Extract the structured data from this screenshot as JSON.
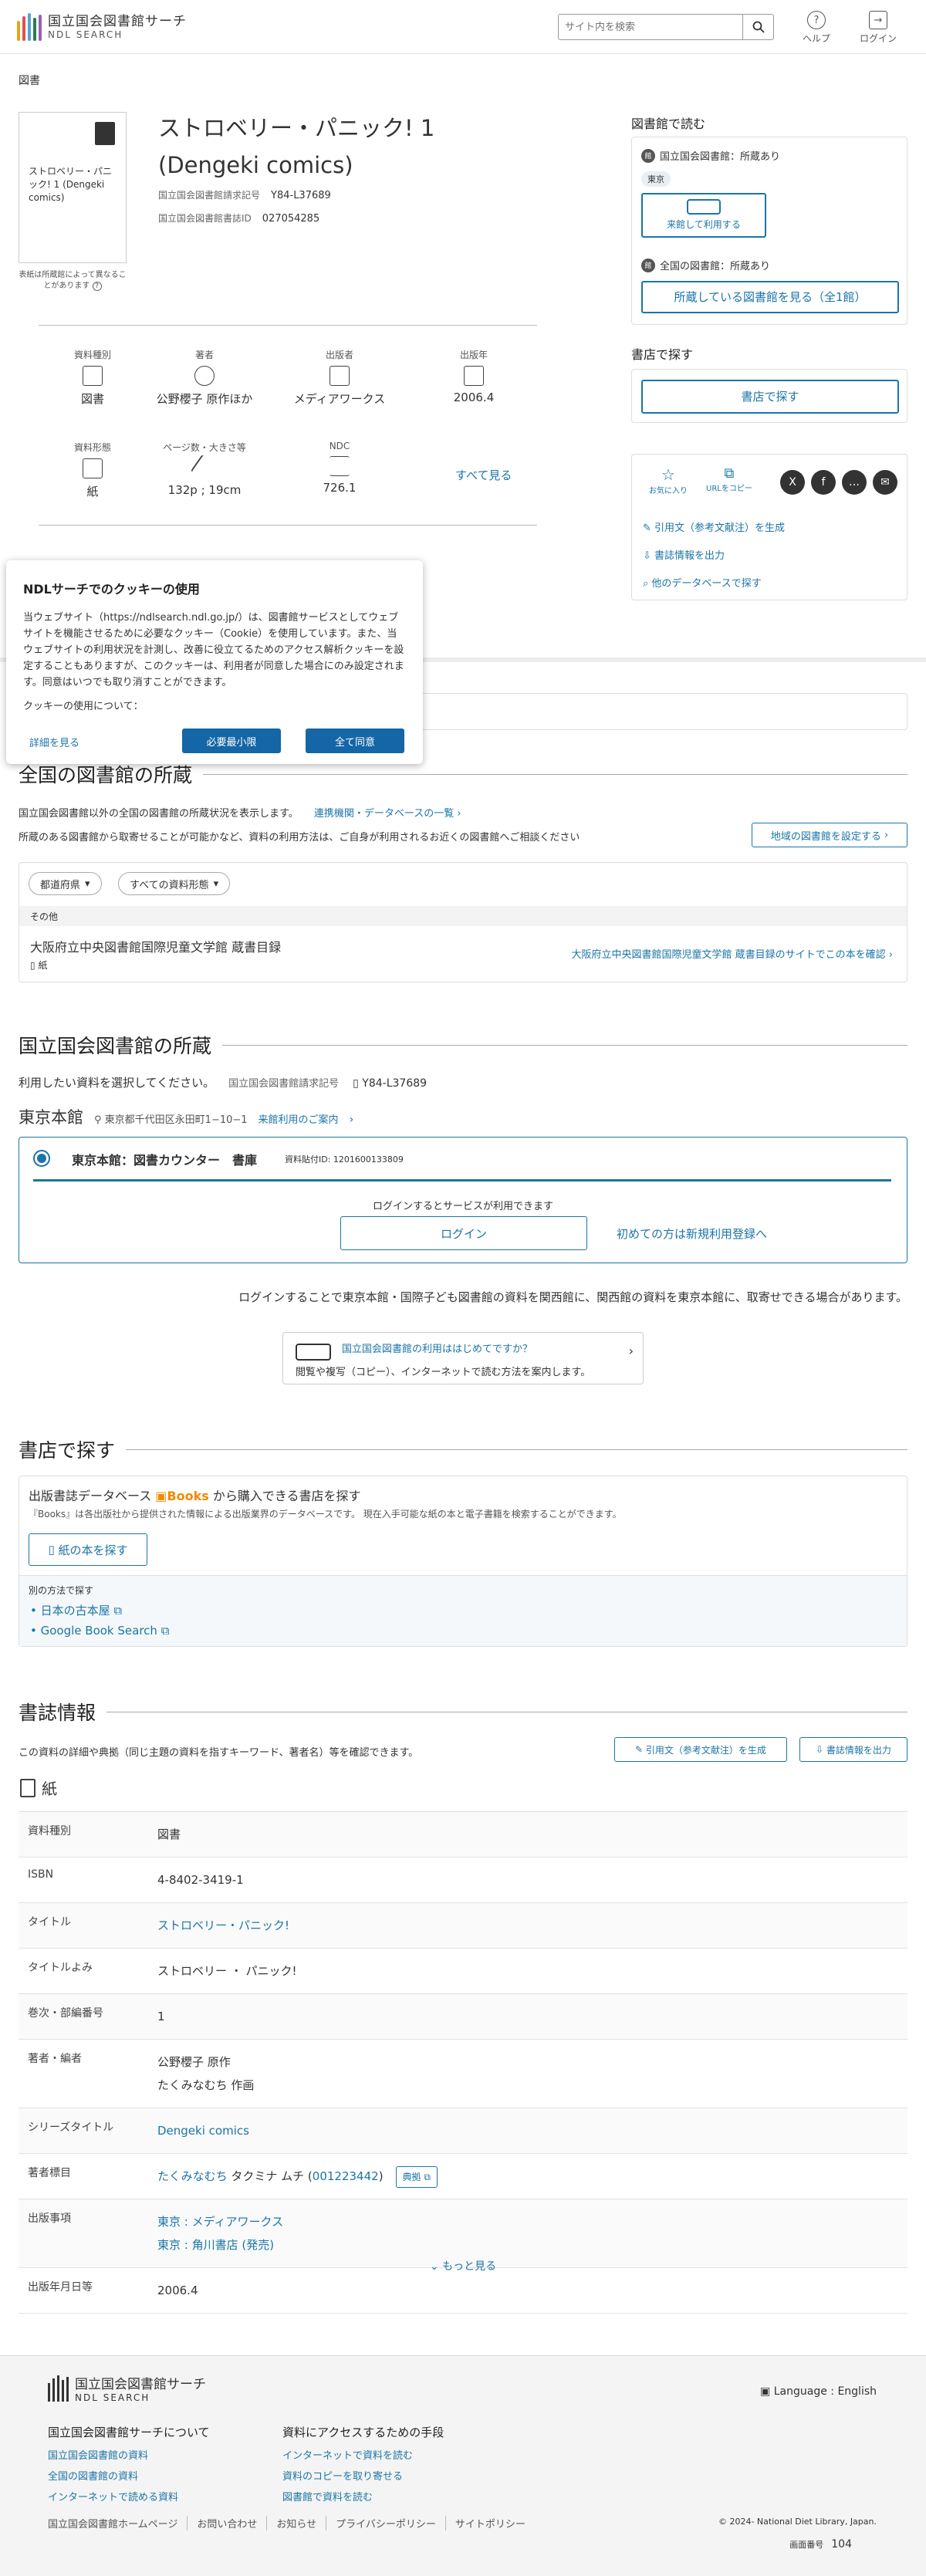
{
  "header": {
    "logo_title": "国立国会図書館サーチ",
    "logo_sub": "NDL SEARCH",
    "search_placeholder": "サイト内を検索",
    "help": "ヘルプ",
    "login": "ログイン"
  },
  "breadcrumb": "図書",
  "book": {
    "cover_text": "ストロベリー・パニック! 1 (Dengeki comics)",
    "cover_note": "表紙は所蔵館によって異なることがあります",
    "title_line1": "ストロベリー・パニック! 1",
    "title_line2": "(Dengeki comics)",
    "call_label": "国立国会図書館請求記号",
    "call_value": "Y84-L37689",
    "id_label": "国立国会図書館書誌ID",
    "id_value": "027054285"
  },
  "facets": [
    {
      "label": "資料種別",
      "value": "図書"
    },
    {
      "label": "著者",
      "value": "公野櫻子 原作ほか"
    },
    {
      "label": "出版者",
      "value": "メディアワークス"
    },
    {
      "label": "出版年",
      "value": "2006.4"
    },
    {
      "label": "資料形態",
      "value": "紙"
    },
    {
      "label": "ページ数・大きさ等",
      "value": "132p ; 19cm"
    },
    {
      "label": "NDC",
      "value": "726.1"
    }
  ],
  "see_all": "すべて見る",
  "sidebar": {
    "read_heading": "図書館で読む",
    "ndl_holding": "国立国会図書館：所蔵あり",
    "tokyo_pill": "東京",
    "visit_button": "来館して利用する",
    "all_holding": "全国の図書館：所蔵あり",
    "see_libraries_button": "所蔵している図書館を見る（全1館）",
    "shop_heading": "書店で探す",
    "shop_button": "書店で探す",
    "favorite": "お気に入り",
    "copy_url": "URLをコピー",
    "cite_link": "引用文（参考文献注）を生成",
    "export_link": "書誌情報を出力",
    "other_db_link": "他のデータベースで探す"
  },
  "cookie": {
    "title": "NDLサーチでのクッキーの使用",
    "body": "当ウェブサイト（https://ndlsearch.ndl.go.jp/）は、図書館サービスとしてウェブサイトを機能させるために必要なクッキー（Cookie）を使用しています。また、当ウェブサイトの利用状況を計測し、改善に役立てるためのアクセス解析クッキーを設定することもありますが、このクッキーは、利用者が同意した場合にのみ設定されます。同意はいつでも取り消すことができます。",
    "about": "クッキーの使用について：",
    "details": "詳細を見る",
    "minimum": "必要最小限",
    "accept_all": "全て同意"
  },
  "national": {
    "heading": "全国の図書館の所蔵",
    "desc1": "国立国会図書館以外の全国の図書館の所蔵状況を表示します。",
    "link_db": "連携機関・データベースの一覧",
    "desc2": "所蔵のある図書館から取寄せることが可能かなど、資料の利用方法は、ご自身が利用されるお近くの図書館へご相談ください",
    "set_library": "地域の図書館を設定する",
    "filter_pref": "都道府県",
    "filter_type": "すべての資料形態",
    "group": "その他",
    "library": "大阪府立中央図書館国際児童文学館 蔵書目録",
    "format": "紙",
    "library_link": "大阪府立中央図書館国際児童文学館 蔵書目録のサイトでこの本を確認"
  },
  "ndl": {
    "heading": "国立国会図書館の所蔵",
    "select_text": "利用したい資料を選択してください。",
    "call_label": "国立国会図書館請求記号",
    "call_value": "Y84-L37689",
    "branch": "東京本館",
    "address": "東京都千代田区永田町1−10−1",
    "visit_info": "来館利用のご案内",
    "counter": "東京本館：図書カウンター　書庫",
    "item_id": "資料貼付ID: 1201600133809",
    "login_prompt": "ログインするとサービスが利用できます",
    "login_button": "ログイン",
    "register_link": "初めての方は新規利用登録へ",
    "kansai_note": "ログインすることで東京本館・国際子ども図書館の資料を関西館に、関西館の資料を東京本館に、取寄せできる場合があります。",
    "first_title": "国立国会図書館の利用ははじめてですか？",
    "first_sub": "閲覧や複写（コピー）、インターネットで読む方法を案内します。"
  },
  "shops": {
    "heading": "書店で探す",
    "books_title_pre": "出版書誌データベース",
    "books_brand": "Books",
    "books_title_post": "から購入できる書店を探す",
    "books_desc": "『Books』は各出版社から提供された情報による出版業界のデータベースです。 現在入手可能な紙の本と電子書籍を検索することができます。",
    "paper_button": "紙の本を探す",
    "other_label": "別の方法で探す",
    "other_links": [
      "日本の古本屋",
      "Google Book Search"
    ]
  },
  "biblio": {
    "heading": "書誌情報",
    "desc": "この資料の詳細や典拠（同じ主題の資料を指すキーワード、著者名）等を確認できます。",
    "cite_button": "引用文（参考文献注）を生成",
    "export_button": "書誌情報を出力",
    "format": "紙",
    "rows": [
      {
        "label": "資料種別",
        "values": [
          "図書"
        ],
        "link": false
      },
      {
        "label": "ISBN",
        "values": [
          "4-8402-3419-1"
        ],
        "link": false
      },
      {
        "label": "タイトル",
        "values": [
          "ストロベリー・パニック!"
        ],
        "link": true
      },
      {
        "label": "タイトルよみ",
        "values": [
          "ストロベリー ・ パニック!"
        ],
        "link": false
      },
      {
        "label": "巻次・部編番号",
        "values": [
          "1"
        ],
        "link": false
      },
      {
        "label": "著者・編者",
        "values": [
          "公野櫻子 原作",
          "たくみなむち 作画"
        ],
        "link": false
      },
      {
        "label": "シリーズタイトル",
        "values": [
          "Dengeki comics"
        ],
        "link": true
      },
      {
        "label": "著者標目",
        "values": [
          "たくみなむち タクミナ ムチ ( 001223442 )"
        ],
        "link": false
      },
      {
        "label": "出版事項",
        "values": [
          "東京 : メディアワークス",
          "東京 : 角川書店 (発売)"
        ],
        "link": true
      },
      {
        "label": "出版年月日等",
        "values": [
          "2006.4"
        ],
        "link": false
      }
    ],
    "author_link": "たくみなむち",
    "author_rest": " タクミナ ムチ (",
    "author_id": "001223442",
    "author_close": ")",
    "authority_button": "典拠",
    "more": "もっと見る"
  },
  "footer": {
    "logo_title": "国立国会図書館サーチ",
    "logo_sub": "NDL SEARCH",
    "language": "Language : English",
    "col1_title": "国立国会図書館サーチについて",
    "col1_links": [
      "国立国会図書館の資料",
      "全国の図書館の資料",
      "インターネットで読める資料"
    ],
    "col2_title": "資料にアクセスするための手段",
    "col2_links": [
      "インターネットで資料を読む",
      "資料のコピーを取り寄せる",
      "図書館で資料を読む"
    ],
    "bottom_links": [
      "国立国会図書館ホームページ",
      "お問い合わせ",
      "お知らせ",
      "プライバシーポリシー",
      "サイトポリシー"
    ],
    "copyright": "© 2024- National Diet Library, Japan.",
    "screen_label": "画面番号",
    "screen_no": "104"
  },
  "colors": {
    "accent": "#1b75a8",
    "brand_orange": "#f08a00"
  }
}
